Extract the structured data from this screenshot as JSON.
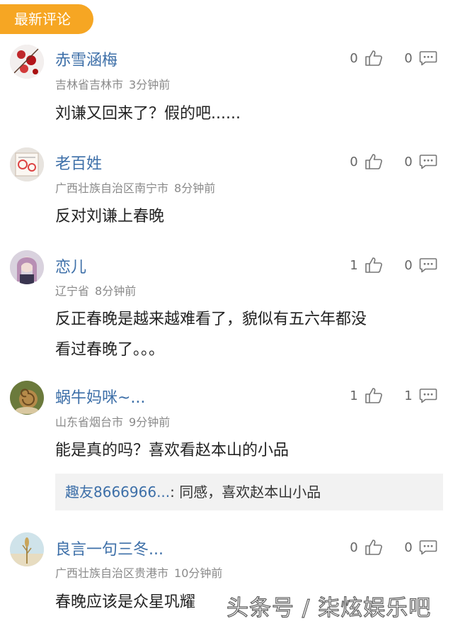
{
  "header": {
    "tab_label": "最新评论"
  },
  "comments": [
    {
      "username": "赤雪涵梅",
      "location": "吉林省吉林市",
      "time": "3分钟前",
      "likes": "0",
      "replies": "0",
      "text": "刘谦又回来了？假的吧......",
      "avatar": "avatar-red-flowers"
    },
    {
      "username": "老百姓",
      "location": "广西壮族自治区南宁市",
      "time": "8分钟前",
      "likes": "0",
      "replies": "0",
      "text": "反对刘谦上春晚",
      "avatar": "avatar-document"
    },
    {
      "username": "恋儿",
      "location": "辽宁省",
      "time": "8分钟前",
      "likes": "1",
      "replies": "0",
      "text_line1": "反正春晚是越来越难看了，貌似有五六年都没",
      "text_line2": "看过春晚了。。。",
      "avatar": "avatar-anime-girl"
    },
    {
      "username": "蜗牛妈咪~...",
      "location": "山东省烟台市",
      "time": "9分钟前",
      "likes": "1",
      "replies": "1",
      "text": "能是真的吗？喜欢看赵本山的小品",
      "avatar": "avatar-snail",
      "reply": {
        "user": "趣友8666966...",
        "text": ": 同感，喜欢赵本山小品"
      }
    },
    {
      "username": "良言一句三冬...",
      "location": "广西壮族自治区贵港市",
      "time": "10分钟前",
      "likes": "0",
      "replies": "0",
      "text": "春晚应该是众星巩耀",
      "avatar": "avatar-wheat"
    }
  ],
  "watermark": "头条号 / 柒炫娱乐吧",
  "icons": {
    "like": "thumbs-up-icon",
    "reply": "comment-bubble-icon"
  },
  "colors": {
    "accent": "#f6a623",
    "username": "#3d6fa8",
    "meta": "#8a8a8a"
  }
}
